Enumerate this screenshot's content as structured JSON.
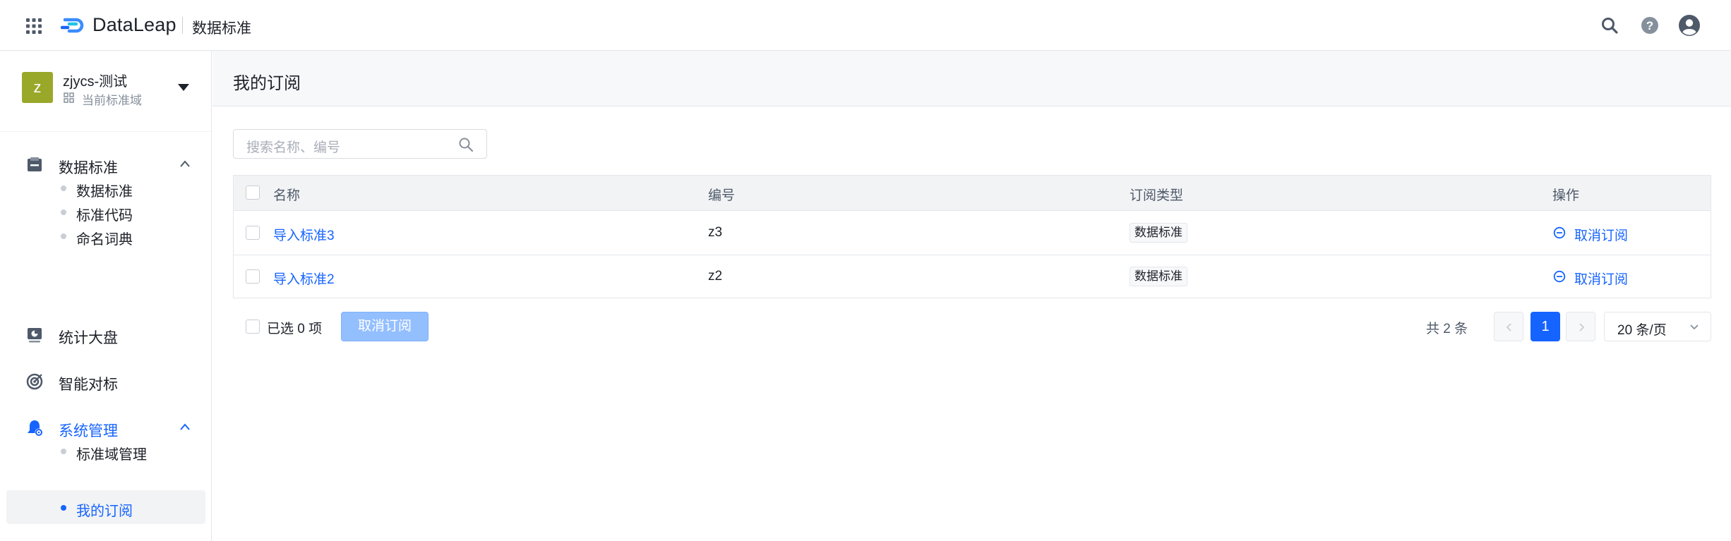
{
  "topbar": {
    "brand": "DataLeap",
    "product": "数据标准",
    "icons": [
      "apps-grid-icon",
      "search-icon",
      "help-icon",
      "user-avatar-icon"
    ]
  },
  "workspace": {
    "avatar_letter": "z",
    "name": "zjycs-测试",
    "subtitle": "当前标准域"
  },
  "sidebar": {
    "groups": [
      {
        "label": "数据标准",
        "icon": "database-icon",
        "expanded": true,
        "items": [
          {
            "label": "数据标准"
          },
          {
            "label": "标准代码"
          },
          {
            "label": "命名词典"
          }
        ]
      },
      {
        "label": "统计大盘",
        "icon": "dashboard-icon"
      },
      {
        "label": "智能对标",
        "icon": "target-icon"
      },
      {
        "label": "系统管理",
        "icon": "settings-bell-icon",
        "expanded": true,
        "active": true,
        "items": [
          {
            "label": "标准域管理"
          },
          {
            "label": "我的订阅",
            "selected": true
          }
        ]
      }
    ]
  },
  "page": {
    "title": "我的订阅"
  },
  "search": {
    "placeholder": "搜索名称、编号"
  },
  "table": {
    "columns": [
      "名称",
      "编号",
      "订阅类型",
      "操作"
    ],
    "rows": [
      {
        "name": "导入标准3",
        "code": "z3",
        "type": "数据标准",
        "action": "取消订阅"
      },
      {
        "name": "导入标准2",
        "code": "z2",
        "type": "数据标准",
        "action": "取消订阅"
      }
    ]
  },
  "footer": {
    "selected_prefix": "已选",
    "selected_count": "0",
    "selected_suffix": "项",
    "bulk_action": "取消订阅",
    "total": "共 2 条",
    "current_page": "1",
    "page_size": "20 条/页"
  },
  "colors": {
    "accent": "#1664ff",
    "workspace_avatar": "#9aa829",
    "disabled_button": "#94bfff"
  }
}
